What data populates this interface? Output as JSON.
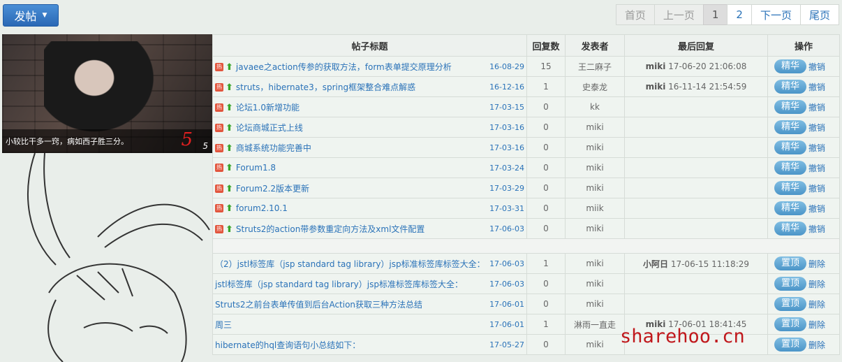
{
  "toolbar": {
    "post_label": "发帖"
  },
  "pagination": {
    "first": "首页",
    "prev": "上一页",
    "pages": [
      "1",
      "2"
    ],
    "next": "下一页",
    "last": "尾页"
  },
  "promo": {
    "caption": "小较比干多一窍，病如西子胜三分。",
    "slide_big": "5",
    "slide_small": "5"
  },
  "table": {
    "headers": [
      "帖子标题",
      "回复数",
      "发表者",
      "最后回复",
      "操作"
    ],
    "rows": [
      {
        "title": "javaee之action传参的获取方法，form表单提交原理分析",
        "date": "16-08-29",
        "replies": "15",
        "author": "王二麻子",
        "last_user": "miki",
        "last_time": "17-06-20 21:06:08",
        "btn": "精华",
        "link": "撤销"
      },
      {
        "title": "struts，hibernate3，spring框架整合难点解惑",
        "date": "16-12-16",
        "replies": "1",
        "author": "史泰龙",
        "last_user": "miki",
        "last_time": "16-11-14 21:54:59",
        "btn": "精华",
        "link": "撤销"
      },
      {
        "title": "论坛1.0新增功能",
        "date": "17-03-15",
        "replies": "0",
        "author": "kk",
        "last_user": "",
        "last_time": "",
        "btn": "精华",
        "link": "撤销"
      },
      {
        "title": "论坛商城正式上线",
        "date": "17-03-16",
        "replies": "0",
        "author": "miki",
        "last_user": "",
        "last_time": "",
        "btn": "精华",
        "link": "撤销"
      },
      {
        "title": "商城系统功能完善中",
        "date": "17-03-16",
        "replies": "0",
        "author": "miki",
        "last_user": "",
        "last_time": "",
        "btn": "精华",
        "link": "撤销"
      },
      {
        "title": "Forum1.8",
        "date": "17-03-24",
        "replies": "0",
        "author": "miki",
        "last_user": "",
        "last_time": "",
        "btn": "精华",
        "link": "撤销"
      },
      {
        "title": "Forum2.2版本更新",
        "date": "17-03-29",
        "replies": "0",
        "author": "miki",
        "last_user": "",
        "last_time": "",
        "btn": "精华",
        "link": "撤销"
      },
      {
        "title": "forum2.10.1",
        "date": "17-03-31",
        "replies": "0",
        "author": "miik",
        "last_user": "",
        "last_time": "",
        "btn": "精华",
        "link": "撤销"
      },
      {
        "title": "Struts2的action带参数重定向方法及xml文件配置",
        "date": "17-06-03",
        "replies": "0",
        "author": "miki",
        "last_user": "",
        "last_time": "",
        "btn": "精华",
        "link": "撤销"
      }
    ],
    "rows2": [
      {
        "title": "（2）jstl标签库（jsp standard tag library）jsp标准标签库标签大全：",
        "date": "17-06-03",
        "replies": "1",
        "author": "miki",
        "last_user": "小阿日",
        "last_time": "17-06-15 11:18:29",
        "btn": "置顶",
        "link": "删除"
      },
      {
        "title": "jstl标签库（jsp standard tag library）jsp标准标签库标签大全：",
        "date": "17-06-03",
        "replies": "0",
        "author": "miki",
        "last_user": "",
        "last_time": "",
        "btn": "置顶",
        "link": "删除"
      },
      {
        "title": "Struts2之前台表单传值到后台Action获取三种方法总结",
        "date": "17-06-01",
        "replies": "0",
        "author": "miki",
        "last_user": "",
        "last_time": "",
        "btn": "置顶",
        "link": "删除"
      },
      {
        "title": "周三",
        "date": "17-06-01",
        "replies": "1",
        "author": "淋雨一直走",
        "last_user": "miki",
        "last_time": "17-06-01 18:41:45",
        "btn": "置顶",
        "link": "删除"
      },
      {
        "title": "hibernate的hql查询语句小总结如下：",
        "date": "17-05-27",
        "replies": "0",
        "author": "miki",
        "last_user": "",
        "last_time": "",
        "btn": "置顶",
        "link": "删除"
      }
    ]
  },
  "watermark": "sharehoo.cn",
  "colors": {
    "link": "#2a72b8",
    "primary": "#2a68b5",
    "hot": "#e2553d",
    "watermark": "#c0181c"
  }
}
